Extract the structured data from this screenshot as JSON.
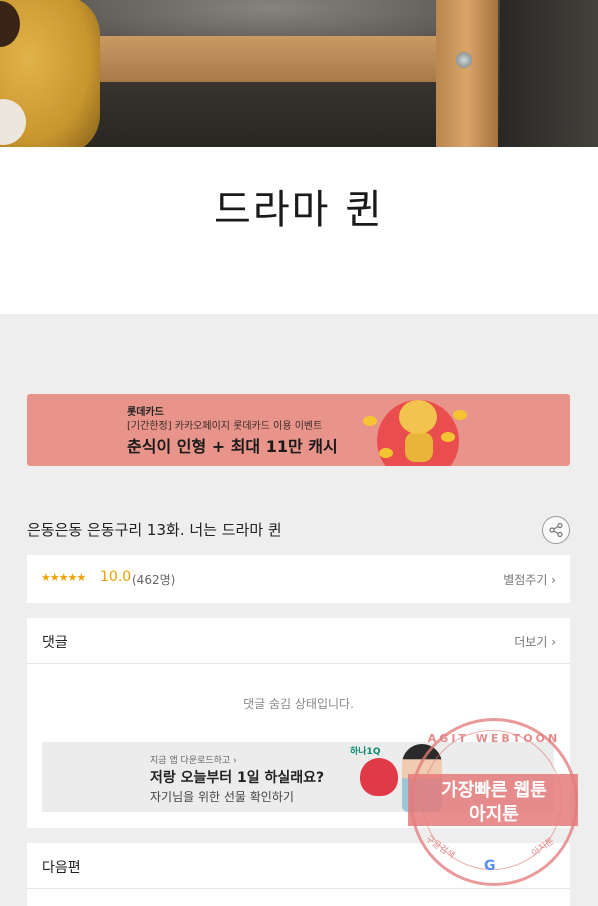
{
  "header_image": {
    "alt": "photo"
  },
  "title_art": {
    "text": "드라마 퀸"
  },
  "ad_banner": {
    "brand": "롯데카드",
    "subtitle": "[기간한정] 카카오페이지 롯데카드 이용 이벤트",
    "headline": "춘식이 인형 + 최대 11만 캐시"
  },
  "episode": {
    "title": "은동은동 은동구리 13화. 너는 드라마 퀸",
    "share_icon": "share-icon"
  },
  "rating": {
    "stars": "★★★★★",
    "score": "10.0",
    "count": "(462명)",
    "rate_button": "별점주기 ›",
    "star_color": "#f2a200"
  },
  "comments": {
    "label": "댓글",
    "more": "더보기 ›",
    "hidden_message": "댓글 숨김 상태입니다."
  },
  "inner_ad": {
    "small_text": "지금 앱 다운로드하고 ›",
    "headline": "저랑 오늘부터 1일 하실래요?",
    "line2": "자기님을 위한 선물 확인하기",
    "logo": "하나1Q"
  },
  "next_episode": {
    "label": "다음편"
  },
  "watermark": {
    "arc_text": "AGIT WEBTOON",
    "line1": "가장빠른 웹툰",
    "line2": "아지툰",
    "arc_left": "구글검색",
    "arc_right": "아지툰",
    "g_letter": "G"
  },
  "colors": {
    "background": "#eeeeee",
    "ad_background": "#e8948a",
    "accent": "#e6a100",
    "watermark": "#e57a7a"
  }
}
